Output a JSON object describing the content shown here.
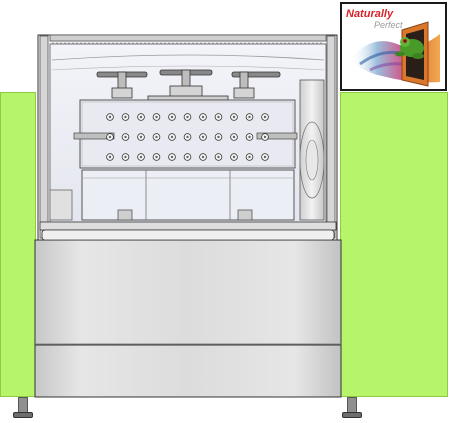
{
  "badge": {
    "title": "Naturally",
    "subtitle": "Perfect"
  },
  "colors": {
    "side_panel": "#b6f56a",
    "machine_body": "#d9d9d9",
    "chamber": "#eef0f7",
    "outline": "#333333"
  },
  "icons": {
    "frog": "frog-icon"
  }
}
